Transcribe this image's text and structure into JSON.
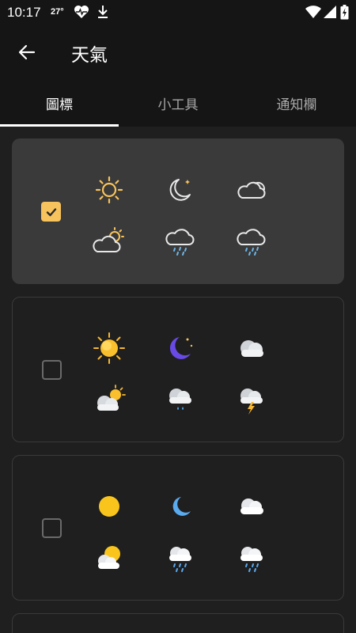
{
  "status_bar": {
    "time": "10:17",
    "temperature": "27°",
    "icons": [
      "heart-pulse-icon",
      "download-icon",
      "wifi-icon",
      "signal-icon",
      "battery-charging-icon"
    ]
  },
  "app_bar": {
    "back_icon": "arrow-left-icon",
    "title": "天氣"
  },
  "tabs": [
    {
      "label": "圖標",
      "active": true
    },
    {
      "label": "小工具",
      "active": false
    },
    {
      "label": "通知欄",
      "active": false
    }
  ],
  "icon_sets": [
    {
      "style": "line",
      "selected": true,
      "icons": [
        "sun-icon",
        "moon-icon",
        "cloud-icon",
        "partly-cloudy-icon",
        "rain-cloud-icon",
        "rain-cloud-icon"
      ]
    },
    {
      "style": "3d",
      "selected": false,
      "icons": [
        "sun-icon",
        "moon-icon",
        "cloud-icon",
        "partly-cloudy-icon",
        "rain-cloud-icon",
        "thunder-cloud-icon"
      ]
    },
    {
      "style": "flat",
      "selected": false,
      "icons": [
        "sun-icon",
        "moon-icon",
        "cloud-icon",
        "partly-cloudy-icon",
        "rain-cloud-icon",
        "rain-cloud-icon"
      ]
    }
  ],
  "colors": {
    "background": "#1f1f1f",
    "bar_background": "#151515",
    "selected_card": "#3a3a3a",
    "accent": "#f7c35c",
    "rain": "#6fb7e8",
    "moon_purple": "#6a4ae6",
    "moon_blue": "#5aaaf0"
  }
}
